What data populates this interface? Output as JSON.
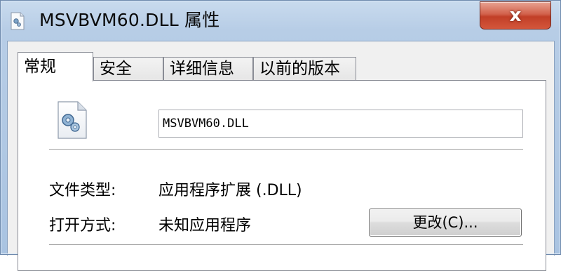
{
  "window": {
    "title": "MSVBVM60.DLL 属性",
    "close_label": "x"
  },
  "tabs": [
    {
      "label": "常规",
      "active": true
    },
    {
      "label": "安全",
      "active": false
    },
    {
      "label": "详细信息",
      "active": false
    },
    {
      "label": "以前的版本",
      "active": false
    }
  ],
  "general": {
    "file_icon": "dll-file-icon",
    "file_name": "MSVBVM60.DLL",
    "file_type_label": "文件类型:",
    "file_type_value": "应用程序扩展 (.DLL)",
    "opens_with_label": "打开方式:",
    "opens_with_value": "未知应用程序",
    "change_button": "更改(C)..."
  },
  "colors": {
    "title_bar": "#b7cde6",
    "close_button": "#c13f27",
    "panel": "#ffffff",
    "dialog_bg": "#f0f0f0"
  }
}
